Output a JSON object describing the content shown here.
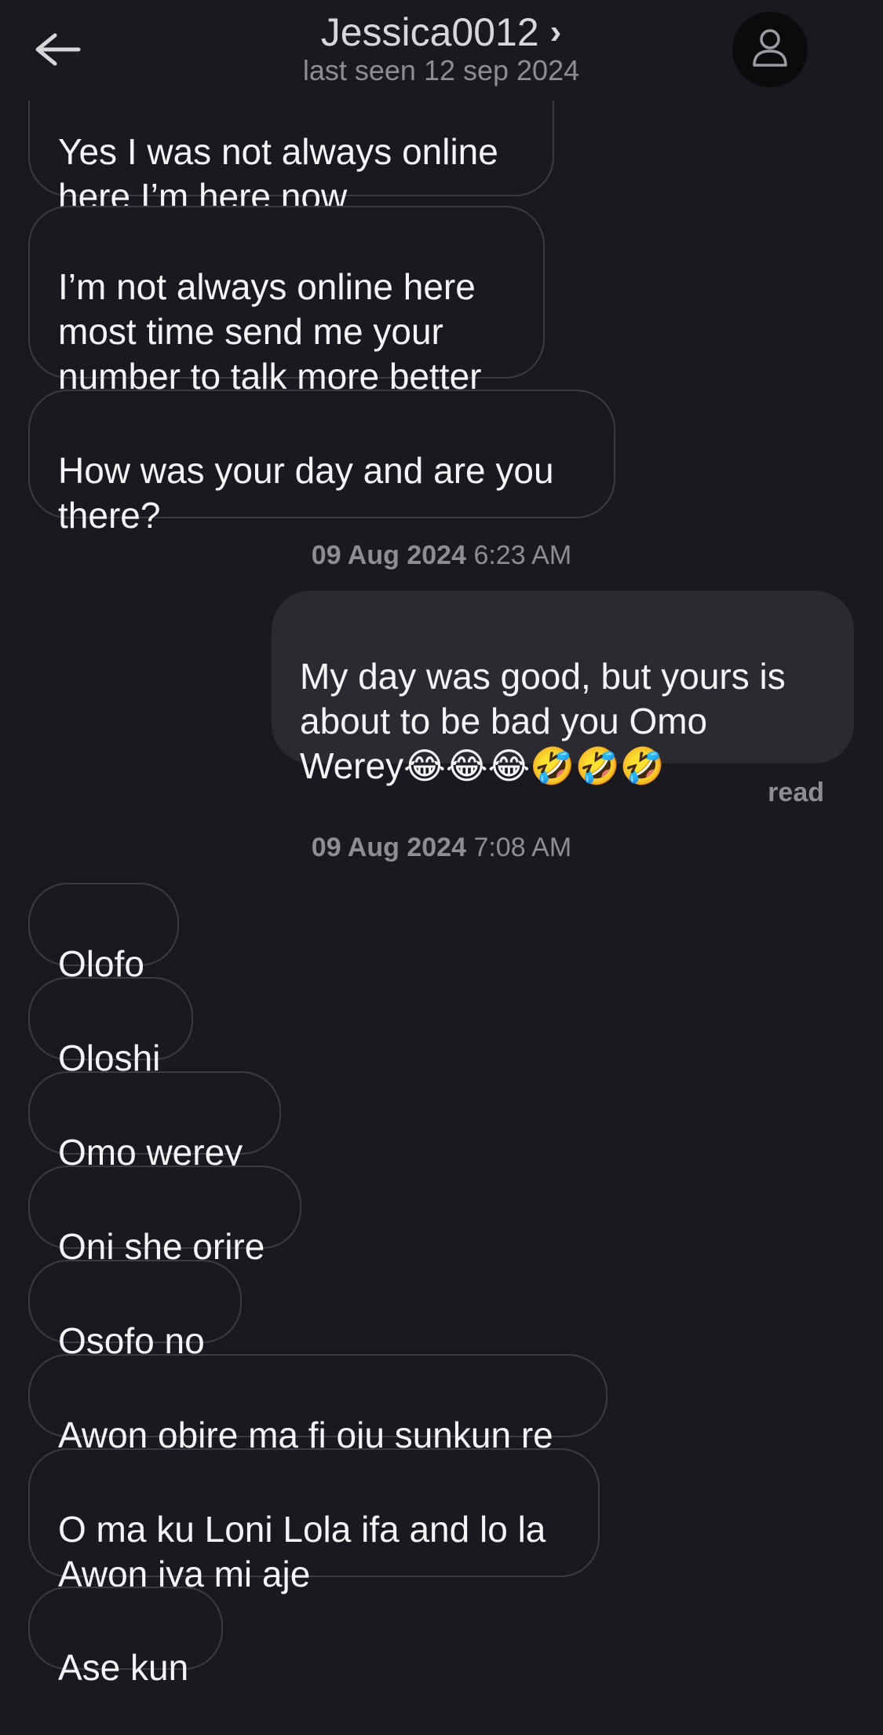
{
  "header": {
    "back_icon": "arrow-left-icon",
    "contact_name": "Jessica0012",
    "name_chevron": "›",
    "last_seen": "last seen 12 sep 2024",
    "avatar_icon": "user-icon"
  },
  "messages": {
    "m1": "Yes I was not always online\nhere I’m here now",
    "m2": "I’m not always online here\nmost time send me your\nnumber to talk more better",
    "m3": "How was your day and are  you\nthere?",
    "stamp1_date": "09 Aug 2024",
    "stamp1_time": "6:23 AM",
    "m4": "My day was good, but yours is\nabout to be bad you Omo\nWerey😂😂😂🤣🤣🤣",
    "read": "read",
    "stamp2_date": "09 Aug 2024",
    "stamp2_time": "7:08 AM",
    "m5": "Olofo",
    "m6": "Oloshi",
    "m7": "Omo werey",
    "m8": "Oni she orire",
    "m9": "Osofo no",
    "m10": "Awon obire ma fi oju sunkun re",
    "m11": "O ma ku Loni Lola ifa and lo la\nAwon iya mi aje",
    "m12": "Ase kun"
  },
  "colors": {
    "background": "#1a191f",
    "received_border": "#3b3b42",
    "sent_bubble": "#2b2a31",
    "meta_text": "#8d8d94"
  }
}
